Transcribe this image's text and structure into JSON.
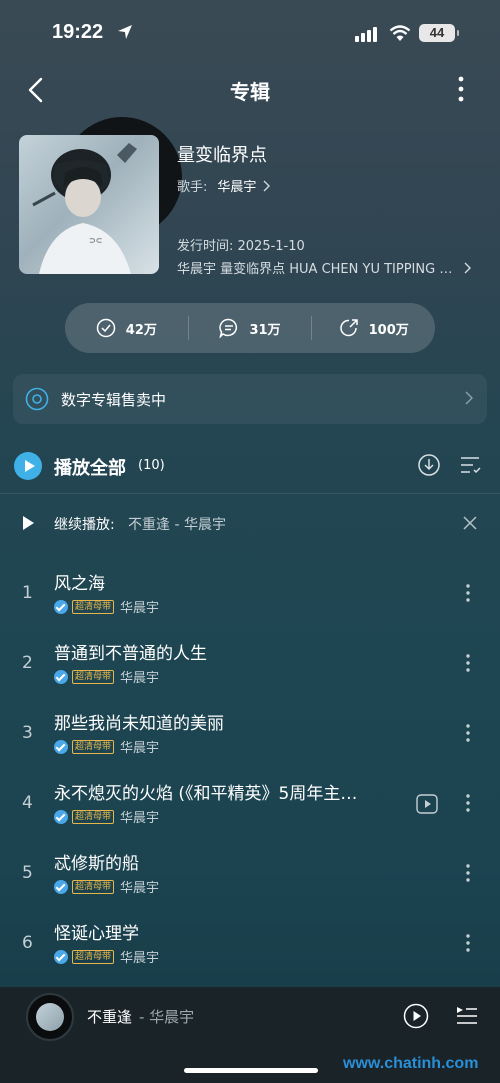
{
  "status": {
    "time": "19:22",
    "battery": "44"
  },
  "nav": {
    "title": "专辑"
  },
  "album": {
    "title": "量变临界点",
    "singer_label": "歌手:",
    "singer": "华晨宇",
    "release": "发行时间: 2025-1-10",
    "description": "华晨宇 量变临界点 HUA CHEN YU TIPPING POINT"
  },
  "stats": {
    "likes": "42万",
    "comments": "31万",
    "shares": "100万"
  },
  "digital": {
    "label": "数字专辑售卖中"
  },
  "play_all": {
    "label": "播放全部",
    "count": "(10)"
  },
  "continue": {
    "label": "继续播放:",
    "song": "不重逢 - 华晨宇"
  },
  "songs": [
    {
      "num": "1",
      "title": "风之海",
      "badge": "超清母带",
      "artist": "华晨宇"
    },
    {
      "num": "2",
      "title": "普通到不普通的人生",
      "badge": "超清母带",
      "artist": "华晨宇"
    },
    {
      "num": "3",
      "title": "那些我尚未知道的美丽",
      "badge": "超清母带",
      "artist": "华晨宇"
    },
    {
      "num": "4",
      "title": "永不熄灭的火焰 (《和平精英》5周年主…",
      "badge": "超清母带",
      "artist": "华晨宇"
    },
    {
      "num": "5",
      "title": "忒修斯的船",
      "badge": "超清母带",
      "artist": "华晨宇"
    },
    {
      "num": "6",
      "title": "怪诞心理学",
      "badge": "超清母带",
      "artist": "华晨宇"
    }
  ],
  "player": {
    "song": "不重逢",
    "artist": "- 华晨宇"
  },
  "watermark": "www.chatinh.com"
}
